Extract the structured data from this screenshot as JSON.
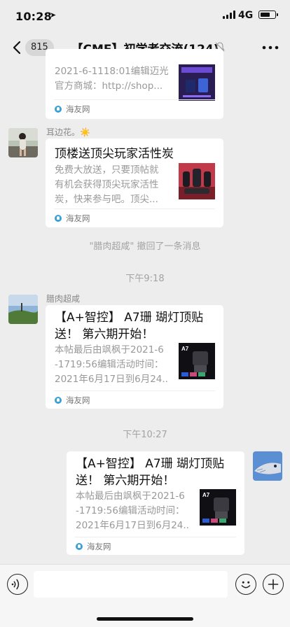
{
  "status_bar": {
    "time": "10:28",
    "network": "4G",
    "battery_level": 0.72
  },
  "nav": {
    "unread_count": "815",
    "title": "【CMF】初学者交流(124)"
  },
  "messages": [
    {
      "type": "link_card",
      "side": "left",
      "partial": true,
      "desc_lines": [
        "2021-6-1118:01编辑迈光",
        "官方商城：http://shop..."
      ],
      "source": "海友网"
    },
    {
      "type": "link_card",
      "side": "left",
      "sender": "耳边花。☀️",
      "title": "顶楼送顶尖玩家活性炭",
      "desc_lines": [
        "免费大放送，只要顶帖就",
        "有机会获得顶尖玩家活性",
        "炭，快来参与吧。顶尖..."
      ],
      "source": "海友网"
    },
    {
      "type": "recall_notice",
      "text": "\"腊肉超咸\" 撤回了一条消息"
    },
    {
      "type": "timestamp",
      "text": "下午9:18"
    },
    {
      "type": "link_card",
      "side": "left",
      "sender": "腊肉超咸",
      "title": "【A+智控】 A7珊 瑚灯顶贴送！ 第六期开始！",
      "desc_lines": [
        "本帖最后由飒枫于2021-6",
        "-1719:56编辑活动时间：",
        "2021年6月17日到6月24..."
      ],
      "source": "海友网"
    },
    {
      "type": "timestamp",
      "text": "下午10:27"
    },
    {
      "type": "link_card",
      "side": "right",
      "title": "【A+智控】 A7珊 瑚灯顶贴送！ 第六期开始！",
      "desc_lines": [
        "本帖最后由飒枫于2021-6",
        "-1719:56编辑活动时间：",
        "2021年6月17日到6月24..."
      ],
      "source": "海友网"
    }
  ],
  "thumbnail_label": "A7",
  "input": {
    "value": ""
  },
  "colors": {
    "background": "#ededed",
    "card": "#ffffff",
    "muted_text": "#999999",
    "source_icon": "#3aa0d8"
  },
  "icons": [
    "back-chevron",
    "mute-bell",
    "more-dots",
    "voice",
    "emoji",
    "plus",
    "location-arrow"
  ]
}
